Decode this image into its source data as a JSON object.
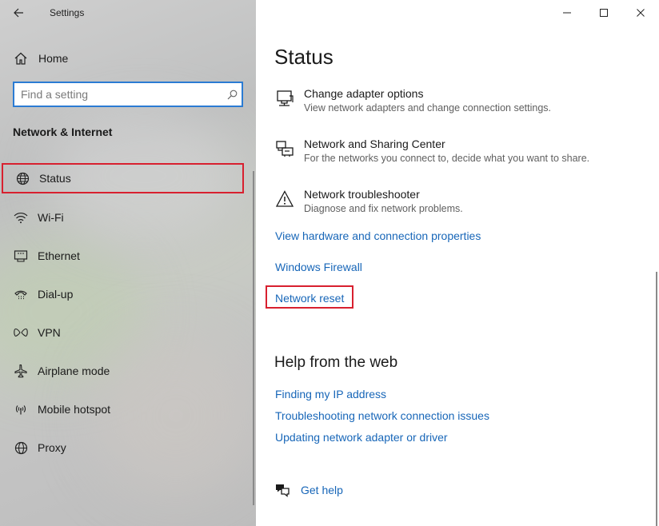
{
  "window": {
    "title": "Settings",
    "controls": [
      "minimize",
      "maximize",
      "close"
    ]
  },
  "sidebar": {
    "home_label": "Home",
    "search": {
      "placeholder": "Find a setting",
      "value": ""
    },
    "section_title": "Network & Internet",
    "items": [
      {
        "label": "Status",
        "icon": "globe-icon",
        "selected": true
      },
      {
        "label": "Wi-Fi",
        "icon": "wifi-icon",
        "selected": false
      },
      {
        "label": "Ethernet",
        "icon": "ethernet-icon",
        "selected": false
      },
      {
        "label": "Dial-up",
        "icon": "dialup-icon",
        "selected": false
      },
      {
        "label": "VPN",
        "icon": "vpn-icon",
        "selected": false
      },
      {
        "label": "Airplane mode",
        "icon": "airplane-icon",
        "selected": false
      },
      {
        "label": "Mobile hotspot",
        "icon": "hotspot-icon",
        "selected": false
      },
      {
        "label": "Proxy",
        "icon": "globe-icon",
        "selected": false
      }
    ]
  },
  "main": {
    "title": "Status",
    "rows": [
      {
        "title": "Change adapter options",
        "desc": "View network adapters and change connection settings.",
        "icon": "monitor-icon"
      },
      {
        "title": "Network and Sharing Center",
        "desc": "For the networks you connect to, decide what you want to share.",
        "icon": "sharing-icon"
      },
      {
        "title": "Network troubleshooter",
        "desc": "Diagnose and fix network problems.",
        "icon": "warning-icon"
      }
    ],
    "links": [
      "View hardware and connection properties",
      "Windows Firewall",
      "Network reset"
    ],
    "help": {
      "title": "Help from the web",
      "links": [
        "Finding my IP address",
        "Troubleshooting network connection issues",
        "Updating network adapter or driver"
      ]
    },
    "get_help_label": "Get help"
  },
  "colors": {
    "accent": "#2b7bd3",
    "link": "#1766b8",
    "highlight_border": "#d8202f"
  }
}
